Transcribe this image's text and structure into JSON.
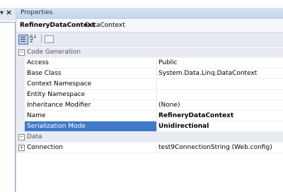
{
  "left_pane": {
    "pin_glyph": "▾",
    "close_glyph": "×"
  },
  "window": {
    "title": "Properties"
  },
  "object": {
    "name": "RefineryDataContext",
    "type": "DataContext"
  },
  "toolbar": {
    "categorized_icon": "categorized-icon",
    "alphabetical_icon": "alphabetical-icon",
    "property_pages_icon": "property-pages-icon"
  },
  "categories": [
    {
      "name": "Code Generation",
      "expander": "−",
      "rows": [
        {
          "label": "Access",
          "value": "Public",
          "bold": false
        },
        {
          "label": "Base Class",
          "value": "System.Data.Linq.DataContext",
          "bold": false
        },
        {
          "label": "Context Namespace",
          "value": "",
          "bold": false
        },
        {
          "label": "Entity Namespace",
          "value": "",
          "bold": false
        },
        {
          "label": "Inheritance Modifier",
          "value": "(None)",
          "bold": false
        },
        {
          "label": "Name",
          "value": "RefineryDataContext",
          "bold": true
        },
        {
          "label": "Serialization Mode",
          "value": "Unidirectional",
          "bold": true,
          "selected": true
        }
      ]
    },
    {
      "name": "Data",
      "expander": "−",
      "rows": [
        {
          "label": "Connection",
          "value": "test9ConnectionString (Web.config)",
          "bold": false,
          "expander": "+"
        }
      ]
    }
  ]
}
